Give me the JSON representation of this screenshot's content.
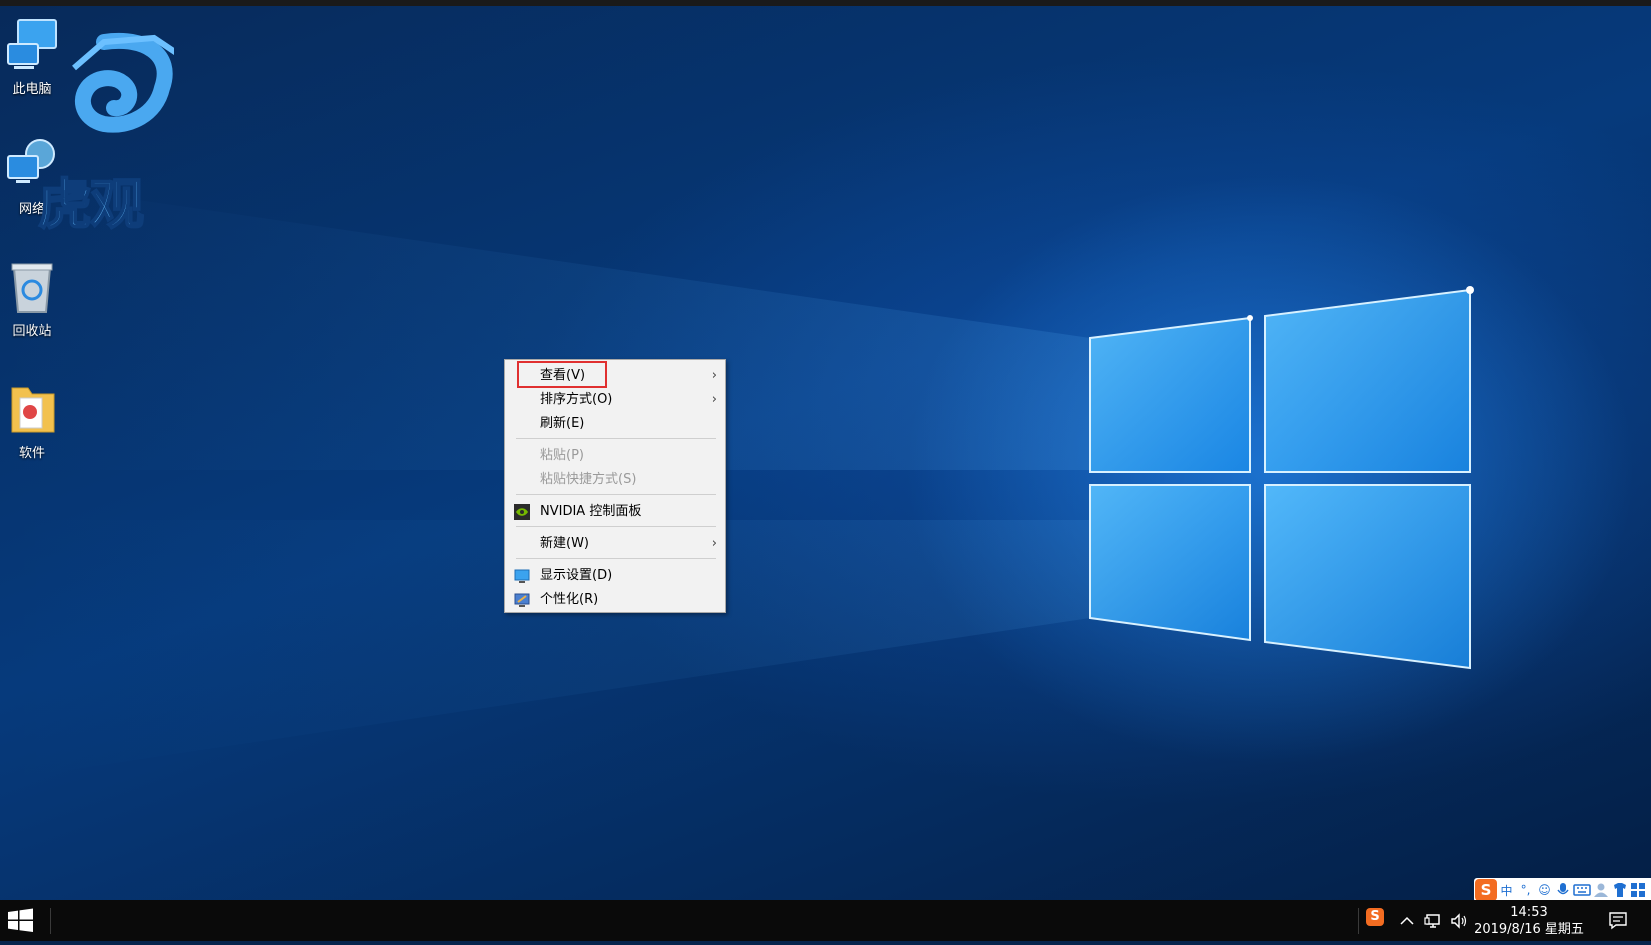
{
  "desktop": {
    "icons": [
      {
        "label": "此电脑",
        "icon": "computer-icon"
      },
      {
        "label": "网络",
        "icon": "network-icon"
      },
      {
        "label": "回收站",
        "icon": "recycle-bin-icon"
      },
      {
        "label": "软件",
        "icon": "folder-icon"
      }
    ],
    "watermark_text": "虎观"
  },
  "context_menu": {
    "items": [
      {
        "label": "查看(V)",
        "submenu": true,
        "enabled": true
      },
      {
        "label": "排序方式(O)",
        "submenu": true,
        "enabled": true
      },
      {
        "label": "刷新(E)",
        "submenu": false,
        "enabled": true
      },
      {
        "label": "粘贴(P)",
        "submenu": false,
        "enabled": false
      },
      {
        "label": "粘贴快捷方式(S)",
        "submenu": false,
        "enabled": false
      },
      {
        "label": "NVIDIA 控制面板",
        "submenu": false,
        "enabled": true,
        "icon": "nvidia-icon"
      },
      {
        "label": "新建(W)",
        "submenu": true,
        "enabled": true
      },
      {
        "label": "显示设置(D)",
        "submenu": false,
        "enabled": true,
        "icon": "display-icon"
      },
      {
        "label": "个性化(R)",
        "submenu": false,
        "enabled": true,
        "icon": "personalize-icon"
      }
    ],
    "chevron": "›",
    "highlighted_item": "查看(V)",
    "highlight_color": "#e03030"
  },
  "ime_toolbar": {
    "logo": "S",
    "mode": "中",
    "punct": "°,",
    "emoji": "☺",
    "icons": [
      "mic-icon",
      "keyboard-icon",
      "user-icon",
      "shirt-icon",
      "grid-icon"
    ]
  },
  "taskbar": {
    "tray_logo": "S",
    "tray_icons": [
      "chevron-up-icon",
      "network-icon",
      "volume-icon"
    ],
    "clock": {
      "time": "14:53",
      "date": "2019/8/16 星期五"
    }
  },
  "colors": {
    "wallpaper": "#063a7c",
    "menu_bg": "#f2f2f2",
    "disabled_text": "#9a9a9a",
    "sogou_orange": "#f36c21",
    "taskbar": "#0a0a0a"
  }
}
